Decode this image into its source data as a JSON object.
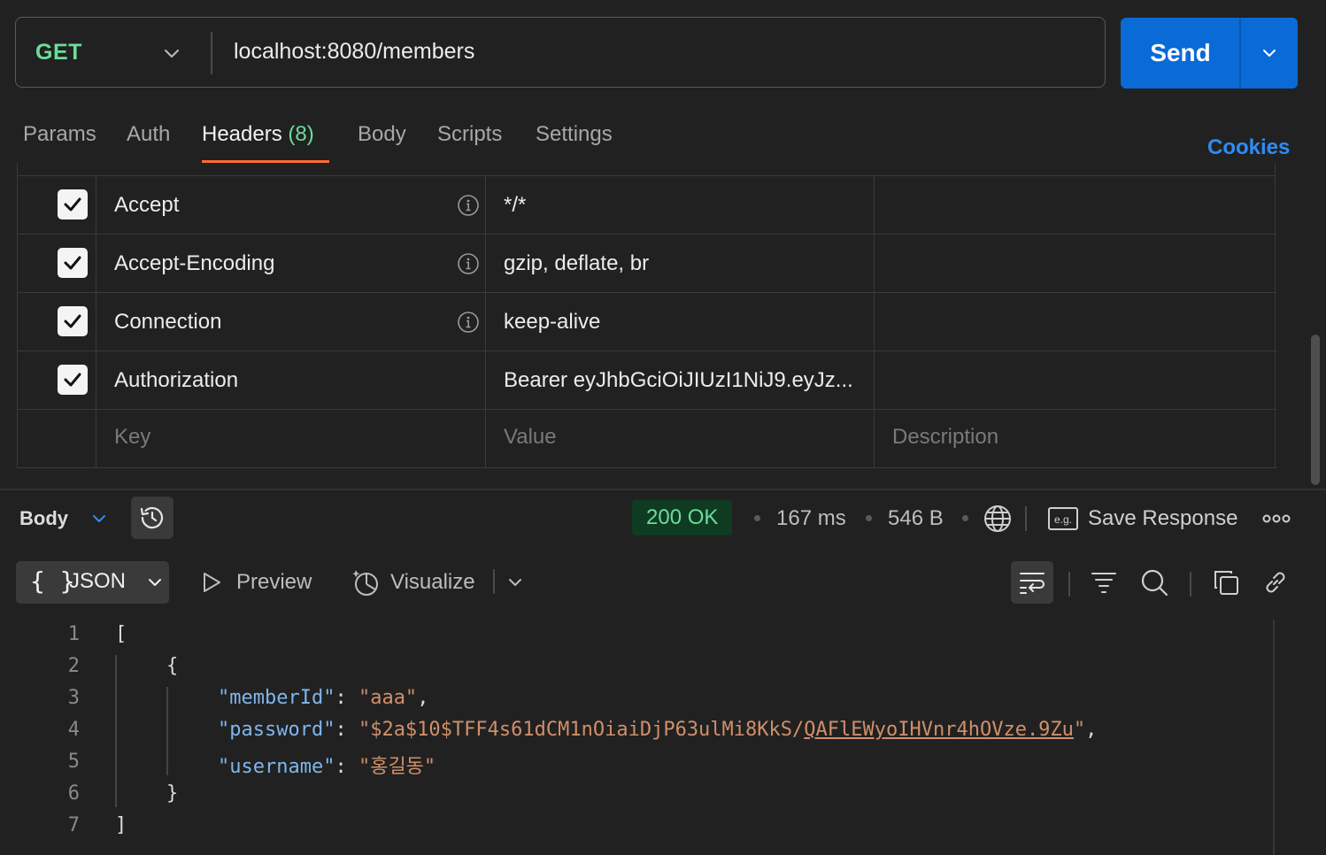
{
  "request": {
    "method": "GET",
    "url": "localhost:8080/members",
    "send_label": "Send"
  },
  "tabs": {
    "params": "Params",
    "auth": "Auth",
    "headers": "Headers",
    "headers_count": "(8)",
    "body": "Body",
    "scripts": "Scripts",
    "settings": "Settings",
    "cookies": "Cookies"
  },
  "headers": {
    "rows": [
      {
        "checked": true,
        "key": "Accept",
        "value": "*/*",
        "info": true
      },
      {
        "checked": true,
        "key": "Accept-Encoding",
        "value": "gzip, deflate, br",
        "info": true
      },
      {
        "checked": true,
        "key": "Connection",
        "value": "keep-alive",
        "info": true
      },
      {
        "checked": true,
        "key": "Authorization",
        "value": "Bearer eyJhbGciOiJIUzI1NiJ9.eyJz...",
        "info": false
      }
    ],
    "placeholders": {
      "key": "Key",
      "value": "Value",
      "description": "Description"
    }
  },
  "response": {
    "body_label": "Body",
    "status": "200 OK",
    "time": "167 ms",
    "size": "546 B",
    "save_label": "Save Response",
    "format": "JSON",
    "preview": "Preview",
    "visualize": "Visualize",
    "lines": [
      "1",
      "2",
      "3",
      "4",
      "5",
      "6",
      "7"
    ],
    "code": {
      "open_bracket": "[",
      "open_brace": "{",
      "k1": "\"memberId\"",
      "v1": "\"aaa\"",
      "k2": "\"password\"",
      "v2a": "\"$2a$10$TFF4s61dCM1nOiaiDjP63ulMi8KkS/",
      "v2b": "QAFlEWyoIHVnr4hOVze.9Zu",
      "v2c": "\"",
      "k3": "\"username\"",
      "v3": "\"홍길동\"",
      "close_brace": "}",
      "close_bracket": "]"
    }
  },
  "colors": {
    "send": "#0a6ad6",
    "method": "#6bdd9a",
    "accent_underline": "#ff6c37",
    "cookies": "#2f8cf5",
    "json_key": "#7fb6ec",
    "json_string": "#d08f6a"
  }
}
